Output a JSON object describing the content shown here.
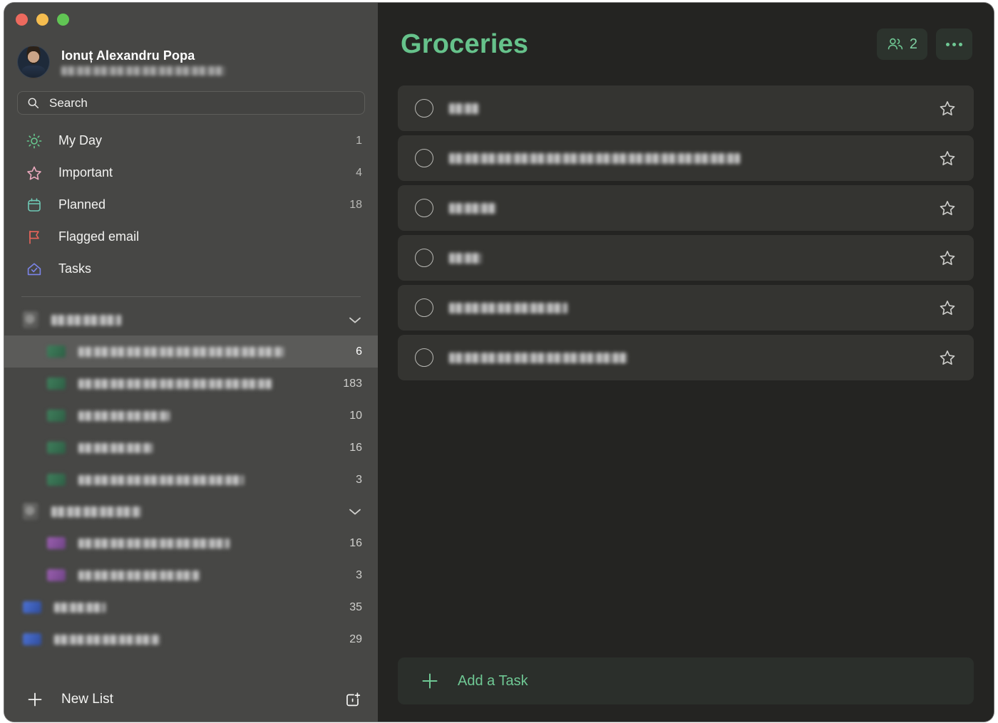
{
  "window": {
    "traffic_lights": [
      {
        "name": "close",
        "color": "#ed6a5e"
      },
      {
        "name": "minimize",
        "color": "#f5bd4f"
      },
      {
        "name": "zoom",
        "color": "#61c554"
      }
    ]
  },
  "sidebar": {
    "profile": {
      "name": "Ionuț Alexandru Popa",
      "email_redacted": true
    },
    "search": {
      "placeholder": "Search",
      "value": ""
    },
    "nav": [
      {
        "label": "My Day",
        "count": "1",
        "icon": "sun-icon",
        "color": "#67c88f"
      },
      {
        "label": "Important",
        "count": "4",
        "icon": "star-icon",
        "color": "#eaa9bd"
      },
      {
        "label": "Planned",
        "count": "18",
        "icon": "calendar-icon",
        "color": "#6fc9b5"
      },
      {
        "label": "Flagged email",
        "count": "",
        "icon": "flag-icon",
        "color": "#e8645a"
      },
      {
        "label": "Tasks",
        "count": "",
        "icon": "house-check-icon",
        "color": "#7b84e8"
      }
    ],
    "groups": [
      {
        "name_redacted": true,
        "name_width": 98,
        "expanded": true,
        "items": [
          {
            "name_redacted": true,
            "name_width": 288,
            "count": "6",
            "icon_color": "green",
            "selected": true
          },
          {
            "name_redacted": true,
            "name_width": 272,
            "count": "183",
            "icon_color": "green",
            "selected": false
          },
          {
            "name_redacted": true,
            "name_width": 128,
            "count": "10",
            "icon_color": "green",
            "selected": false
          },
          {
            "name_redacted": true,
            "name_width": 104,
            "count": "16",
            "icon_color": "green",
            "selected": false
          },
          {
            "name_redacted": true,
            "name_width": 232,
            "count": "3",
            "icon_color": "green",
            "selected": false
          }
        ]
      },
      {
        "name_redacted": true,
        "name_width": 126,
        "expanded": true,
        "items": [
          {
            "name_redacted": true,
            "name_width": 212,
            "count": "16",
            "icon_color": "purple",
            "selected": false
          },
          {
            "name_redacted": true,
            "name_width": 170,
            "count": "3",
            "icon_color": "purple",
            "selected": false
          }
        ]
      }
    ],
    "root_items": [
      {
        "name_redacted": true,
        "name_width": 72,
        "count": "35",
        "icon_color": "blue",
        "selected": false
      },
      {
        "name_redacted": true,
        "name_width": 148,
        "count": "29",
        "icon_color": "blue",
        "selected": false
      }
    ],
    "new_list": {
      "label": "New List",
      "plus_icon": "plus-icon",
      "group_icon": "new-group-icon"
    }
  },
  "main": {
    "title": "Groceries",
    "title_color": "#66c28b",
    "share_button": {
      "icon": "people-icon",
      "count": "2"
    },
    "more_button": {
      "icon": "ellipsis-icon"
    },
    "tasks": [
      {
        "title_redacted": true,
        "title_width": 42,
        "completed": false,
        "starred": false
      },
      {
        "title_redacted": true,
        "title_width": 408,
        "completed": false,
        "starred": false
      },
      {
        "title_redacted": true,
        "title_width": 66,
        "completed": false,
        "starred": false
      },
      {
        "title_redacted": true,
        "title_width": 46,
        "completed": false,
        "starred": false
      },
      {
        "title_redacted": true,
        "title_width": 166,
        "completed": false,
        "starred": false
      },
      {
        "title_redacted": true,
        "title_width": 250,
        "completed": false,
        "starred": false
      }
    ],
    "add_task": {
      "label": "Add a Task",
      "icon": "plus-icon"
    }
  }
}
